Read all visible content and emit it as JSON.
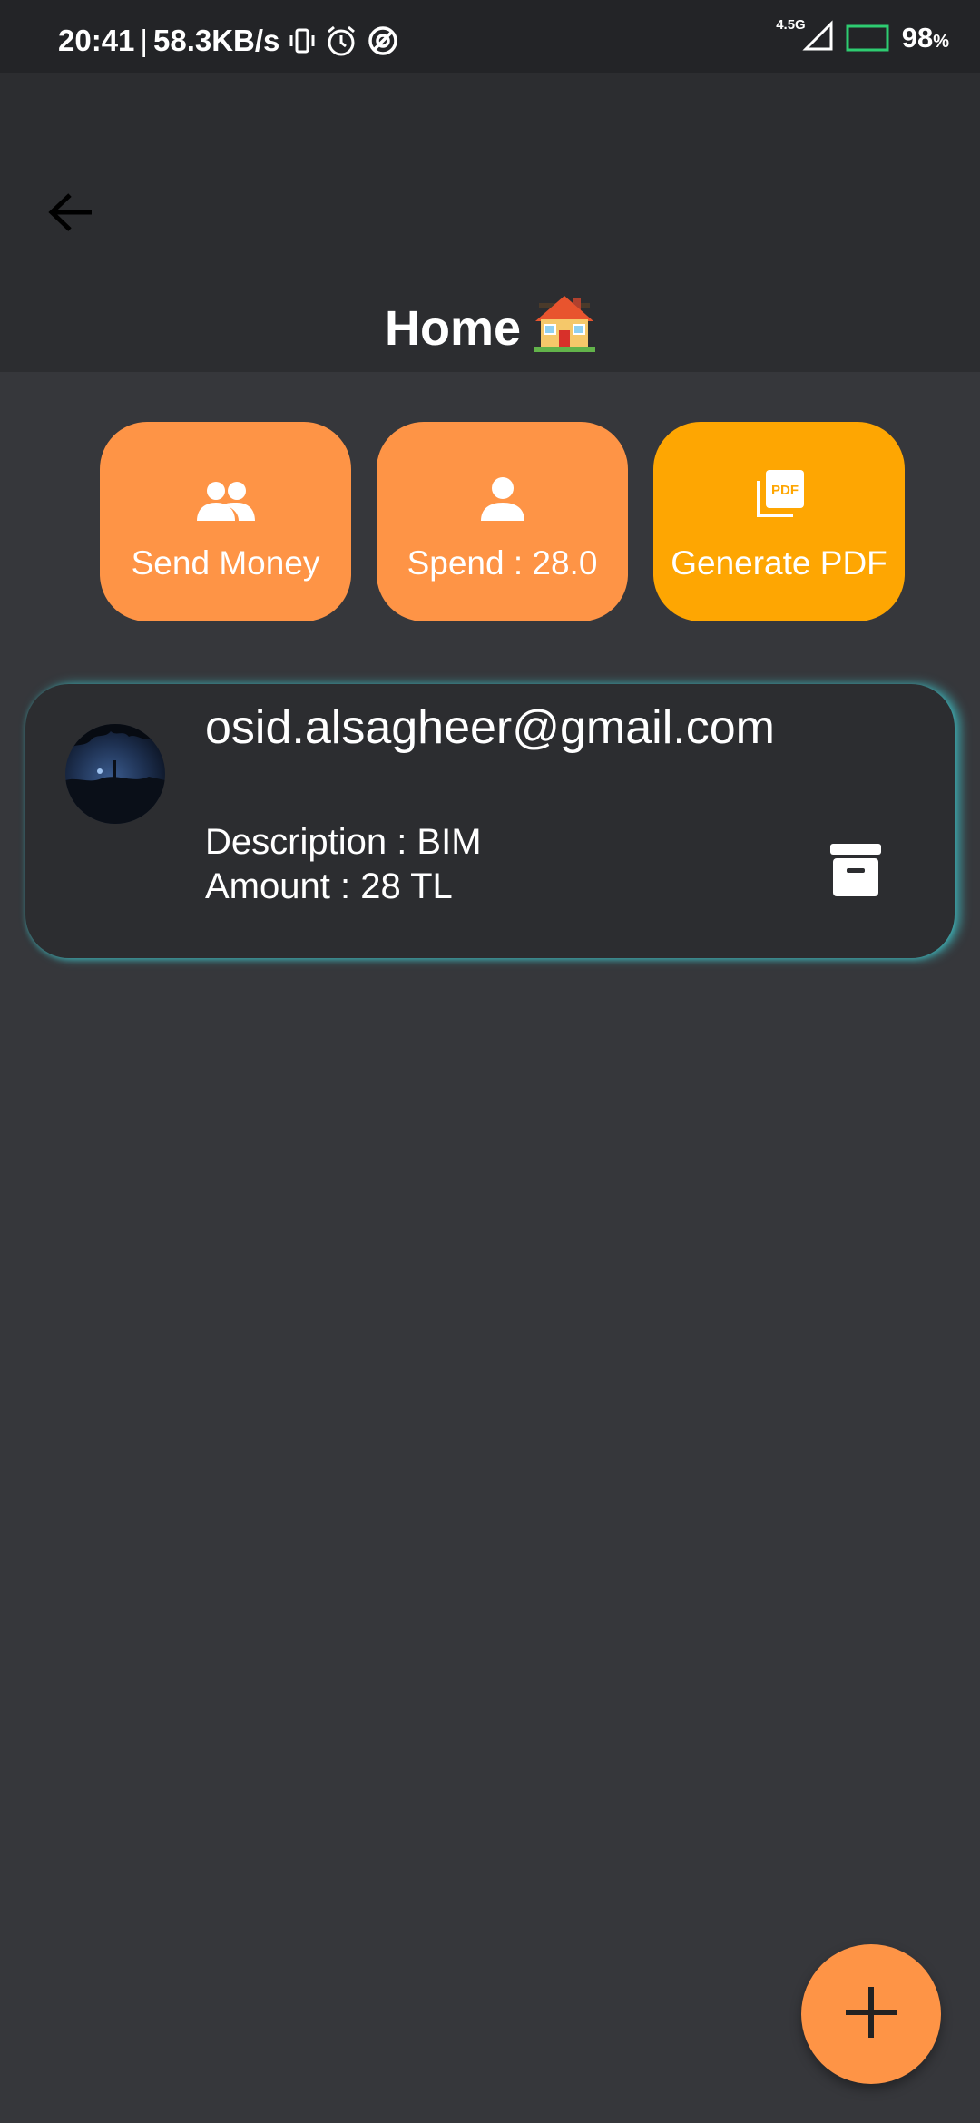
{
  "status_bar": {
    "time": "20:41",
    "separator": "|",
    "net_speed": "58.3KB/s",
    "network_type": "4.5G",
    "battery": "98",
    "battery_unit": "%",
    "icons": [
      "vibrate-icon",
      "alarm-icon",
      "data-saver-icon",
      "signal-icon",
      "battery-icon"
    ]
  },
  "header": {
    "title": "Home",
    "title_emoji": "house-emoji",
    "back_icon": "arrow-left-icon"
  },
  "actions": [
    {
      "label": "Send Money",
      "icon": "people-icon",
      "color": "#fe9446"
    },
    {
      "label": "Spend : 28.0",
      "icon": "person-icon",
      "color": "#fe9446"
    },
    {
      "label": "Generate PDF",
      "icon": "pdf-icon",
      "pdf_text": "PDF",
      "color": "#fea602"
    }
  ],
  "transactions": [
    {
      "email": "osid.alsagheer@gmail.com",
      "description": "Description : BIM",
      "amount": "Amount : 28 TL",
      "action_icon": "archive-icon"
    }
  ],
  "fab": {
    "icon": "plus-icon"
  },
  "colors": {
    "background": "#36373b",
    "app_bar": "#2c2d30",
    "status_bar": "#232427",
    "accent": "#fe9446",
    "accent_alt": "#fea602",
    "card_glow": "#40c8cd",
    "battery_outline": "#2ecc71"
  }
}
